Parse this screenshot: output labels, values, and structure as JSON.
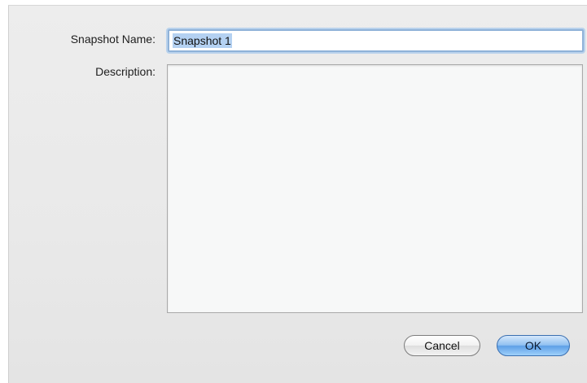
{
  "dialog": {
    "name_label": "Snapshot Name:",
    "name_value": "Snapshot 1",
    "description_label": "Description:",
    "description_value": "",
    "cancel_label": "Cancel",
    "ok_label": "OK"
  },
  "colors": {
    "accent": "#5d9fe6",
    "selection": "#b4d1f2",
    "background": "#ececec"
  }
}
